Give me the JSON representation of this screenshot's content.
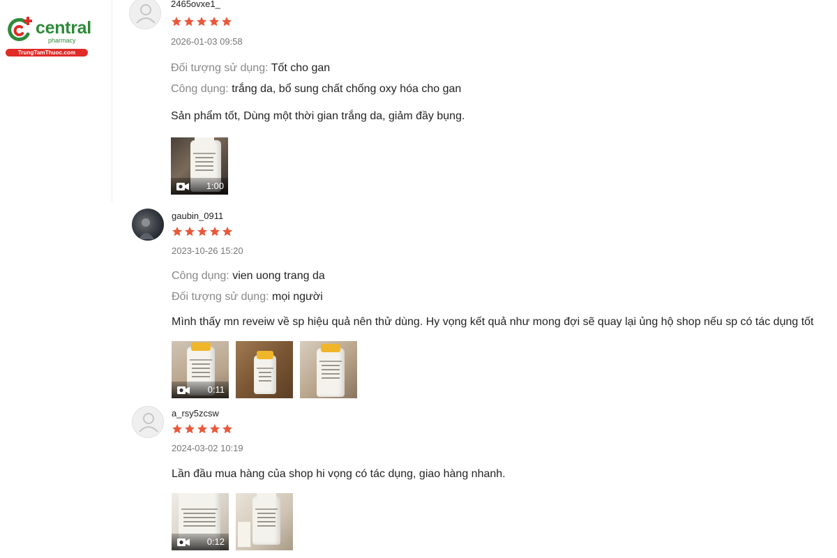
{
  "brand": {
    "name": "central",
    "sub": "pharmacy",
    "site": "TrungTamThuoc.com",
    "colors": {
      "green": "#2e8b3a",
      "red": "#e02b27",
      "star": "#e8583a"
    }
  },
  "reviews": [
    {
      "username": "2465ovxe1_",
      "rating": 5,
      "date": "2026-01-03 09:58",
      "attributes": [
        {
          "label": "Đối tượng sử dụng:",
          "value": "Tốt cho gan"
        },
        {
          "label": "Công dụng:",
          "value": "trắng da, bổ sung chất chống oxy hóa cho gan"
        }
      ],
      "comment": "Sản phẩm tốt, Dùng một thời gian trắng da, giảm đầy bụng.",
      "media": [
        {
          "type": "video",
          "duration": "1:00"
        }
      ]
    },
    {
      "username": "gaubin_0911",
      "rating": 5,
      "date": "2023-10-26 15:20",
      "attributes": [
        {
          "label": "Công dụng:",
          "value": "vien uong trang da"
        },
        {
          "label": "Đối tượng sử dụng:",
          "value": "mọi người"
        }
      ],
      "comment": "Mình thấy mn reveiw về sp hiệu quả nên thử dùng. Hy vọng kết quả như mong đợi sẽ quay lại ủng hộ shop nếu sp có tác dụng tốt",
      "media": [
        {
          "type": "video",
          "duration": "0:11"
        },
        {
          "type": "image"
        },
        {
          "type": "image"
        }
      ]
    },
    {
      "username": "a_rsy5zcsw",
      "rating": 5,
      "date": "2024-03-02 10:19",
      "attributes": [],
      "comment": "Lần đầu mua hàng của shop hi vọng có tác dụng, giao hàng nhanh.",
      "media": [
        {
          "type": "video",
          "duration": "0:12"
        },
        {
          "type": "image"
        }
      ]
    }
  ]
}
